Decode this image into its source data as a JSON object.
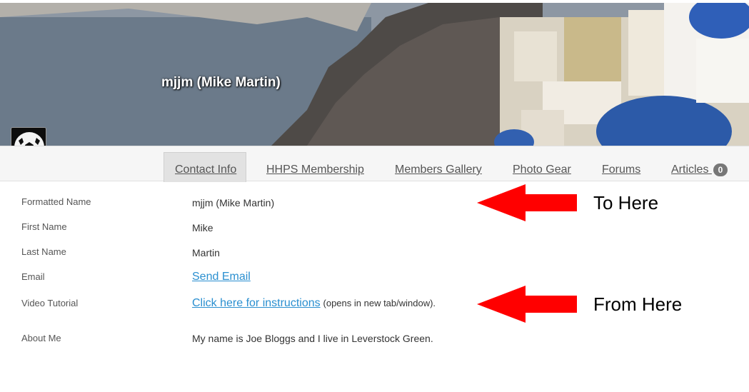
{
  "profile": {
    "display_name": "mjjm (Mike Martin)",
    "status": "online"
  },
  "tabs": [
    {
      "label": "Contact Info",
      "active": true
    },
    {
      "label": "HHPS Membership",
      "active": false
    },
    {
      "label": "Members Gallery",
      "active": false
    },
    {
      "label": "Photo Gear",
      "active": false
    },
    {
      "label": "Forums",
      "active": false
    },
    {
      "label": "Articles",
      "active": false,
      "badge": "0"
    }
  ],
  "fields": {
    "formatted_name": {
      "label": "Formatted Name",
      "value": "mjjm (Mike Martin)"
    },
    "first_name": {
      "label": "First Name",
      "value": "Mike"
    },
    "last_name": {
      "label": "Last Name",
      "value": "Martin"
    },
    "email": {
      "label": "Email",
      "link_text": "Send Email"
    },
    "video_tutorial": {
      "label": "Video Tutorial",
      "link_text": "Click here for instructions",
      "note": "(opens in new tab/window)."
    },
    "about_me": {
      "label": "About Me",
      "value": "My name is Joe Bloggs and I live in Leverstock Green."
    }
  },
  "annotations": {
    "to_here": "To Here",
    "from_here": "From Here",
    "arrow_color": "#ff0000"
  },
  "colors": {
    "link": "#2a8fd0",
    "online": "#5cb85c",
    "badge": "#777777"
  }
}
